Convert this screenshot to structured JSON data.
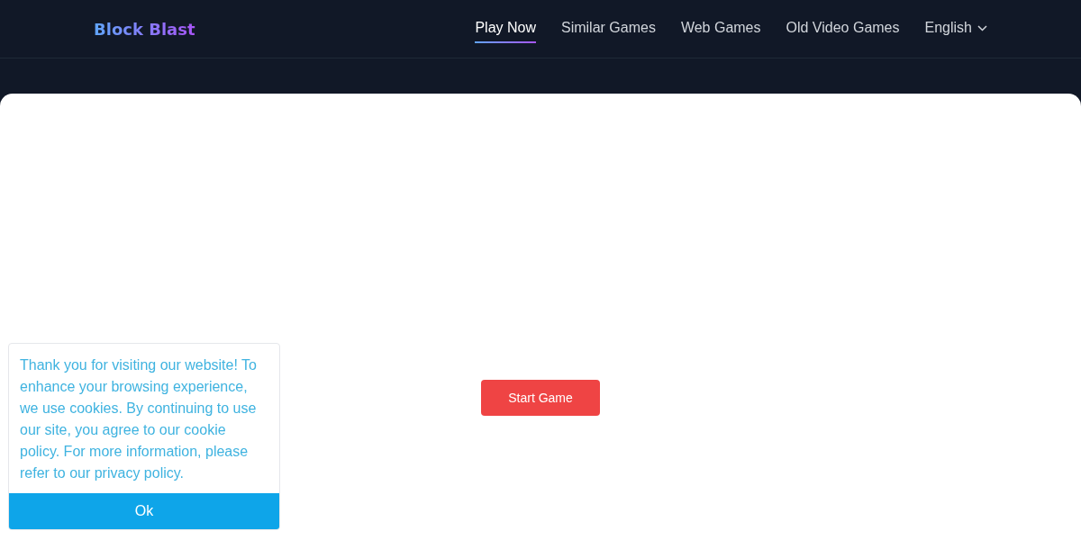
{
  "header": {
    "logo": "Block Blast",
    "nav": [
      {
        "label": "Play Now",
        "selected": true
      },
      {
        "label": "Similar Games",
        "selected": false
      },
      {
        "label": "Web Games",
        "selected": false
      },
      {
        "label": "Old Video Games",
        "selected": false
      }
    ],
    "language": "English"
  },
  "game": {
    "start_button": "Start Game"
  },
  "cookie_banner": {
    "message": "Thank you for visiting our website! To enhance your browsing experience, we use cookies. By continuing to use our site, you agree to our cookie policy. For more information, please refer to our privacy policy.",
    "button": "Ok"
  }
}
